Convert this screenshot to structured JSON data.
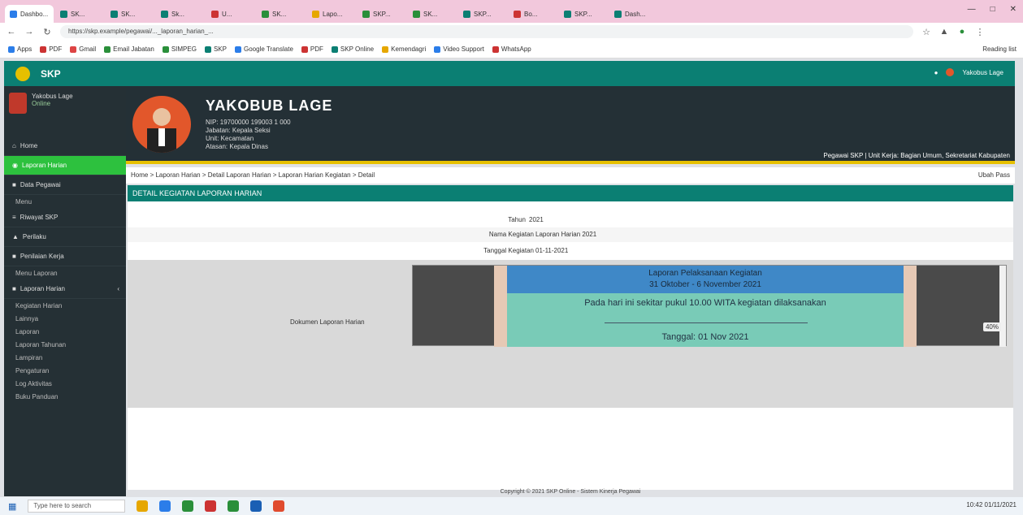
{
  "browser": {
    "tabs": [
      "Dashbo...",
      "SK...",
      "SK...",
      "Sk...",
      "U...",
      "SK...",
      "Lapo...",
      "SKP...",
      "SK...",
      "SKP...",
      "Bo...",
      "SKP...",
      "Dash..."
    ],
    "url": "https://skp.example/pegawai/..._laporan_harian_...",
    "bookmarks": [
      "Apps",
      "PDF",
      "Gmail",
      "Email Jabatan",
      "SIMPEG",
      "SKP",
      "Google Translate",
      "PDF",
      "SKP Online",
      "Kemendagri",
      "Video Support",
      "WhatsApp"
    ],
    "reading_list": "Reading list"
  },
  "app": {
    "brand": "SKP",
    "user_menu": "Yakobus Lage"
  },
  "sidebar": {
    "user_name": "Yakobus Lage",
    "user_status": "Online",
    "items": [
      "Home",
      "Laporan Harian",
      "Data Pegawai",
      "Menu",
      "Riwayat SKP",
      "Perilaku",
      "Penilaian Kerja",
      "Menu Laporan",
      "Laporan Harian",
      "Kegiatan Harian",
      "Lainnya",
      "Laporan",
      "Laporan Tahunan",
      "Lampiran",
      "Pengaturan",
      "Log Aktivitas",
      "Buku Panduan"
    ]
  },
  "profile": {
    "name": "YAKOBUB LAGE",
    "details": [
      "NIP: 19700000 199003 1 000",
      "Jabatan: Kepala Seksi",
      "Unit: Kecamatan",
      "Atasan: Kepala Dinas"
    ],
    "role": "Pegawai SKP   |   Unit Kerja: Bagian Umum, Sekretariat Kabupaten"
  },
  "breadcrumb": {
    "path": "Home > Laporan Harian > Detail Laporan Harian > Laporan Harian Kegiatan > Detail",
    "action": "Ubah Pass"
  },
  "card": {
    "title": "DETAIL KEGIATAN LAPORAN HARIAN",
    "fields": [
      {
        "label": "Tahun",
        "value": "2021"
      },
      {
        "label": "Nama Kegiatan",
        "value": "Laporan Harian 2021"
      },
      {
        "label": "Tanggal Kegiatan",
        "value": "01-11-2021"
      }
    ],
    "viewer_label": "Dokumen Laporan Harian",
    "doc": {
      "line_a": "Laporan Pelaksanaan Kegiatan",
      "line_b": "31 Oktober - 6 November 2021",
      "line_c": "Pada hari ini sekitar pukul 10.00 WITA kegiatan dilaksanakan",
      "line_d": "Tanggal: 01 Nov 2021"
    },
    "zoom": "40%"
  },
  "footer": "Copyright © 2021 SKP Online - Sistem Kinerja Pegawai",
  "taskbar": {
    "search": "Type here to search",
    "clock": "10:42  01/11/2021"
  }
}
